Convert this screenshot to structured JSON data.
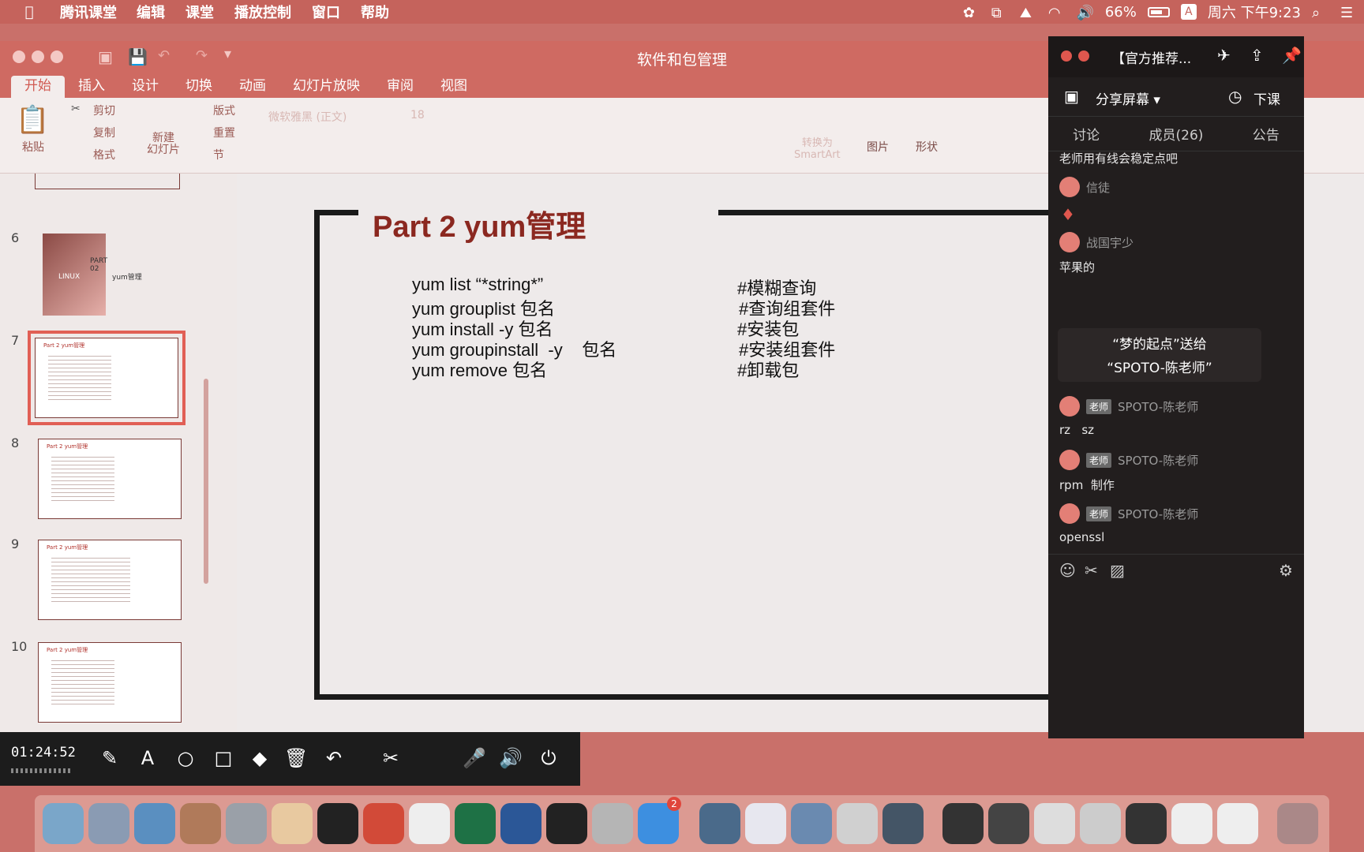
{
  "menubar": {
    "app_name": "腾讯课堂",
    "menus": [
      "编辑",
      "课堂",
      "播放控制",
      "窗口",
      "帮助"
    ],
    "battery": "66%",
    "input_method": "A",
    "clock": "周六 下午9:23"
  },
  "ppt": {
    "doc_title": "软件和包管理",
    "tabs": [
      "开始",
      "插入",
      "设计",
      "切换",
      "动画",
      "幻灯片放映",
      "审阅",
      "视图"
    ],
    "ribbon": {
      "paste": "粘贴",
      "cut": "剪切",
      "copy": "复制",
      "format": "格式",
      "new_slide": "新建\n幻灯片",
      "layout": "版式",
      "reset": "重置",
      "section": "节",
      "font_name": "微软雅黑 (正文)",
      "font_size": "18",
      "smartart": "转换为\nSmartArt",
      "picture": "图片",
      "shape": "形状"
    },
    "thumbnails": [
      {
        "num": "6",
        "title": "PART 02",
        "subtitle": "yum管理",
        "logo": "LINUX"
      },
      {
        "num": "7",
        "title": "Part 2 yum管理"
      },
      {
        "num": "8",
        "title": "Part 2 yum管理"
      },
      {
        "num": "9",
        "title": "Part 2 yum管理"
      },
      {
        "num": "10",
        "title": "Part 2 yum管理"
      }
    ]
  },
  "slide": {
    "title": "Part 2 yum管理",
    "commands": [
      {
        "cmd": "yum list “*string*”",
        "comment": "#模糊查询"
      },
      {
        "cmd": "yum grouplist  包名",
        "comment": "#查询组套件"
      },
      {
        "cmd": "yum install -y 包名",
        "comment": "#安装包"
      },
      {
        "cmd": "yum groupinstall  -y    包名",
        "comment": "#安装组套件"
      },
      {
        "cmd": "yum remove 包名",
        "comment": "#卸载包"
      }
    ]
  },
  "chat": {
    "title": "【官方推荐...",
    "share_screen": "分享屏幕",
    "end_class": "下课",
    "tabs": [
      "讨论",
      "成员(26)",
      "公告"
    ],
    "messages": {
      "top_msg": "老师用有线会稳定点吧",
      "user1": "信徒",
      "user2": "战国宇少",
      "user2_msg": "苹果的",
      "gift_line1": "“梦的起点”送给",
      "gift_line2": "“SPOTO-陈老师”",
      "teacher_badge": "老师",
      "teacher_name": "SPOTO-陈老师",
      "t_msg1": "rz   sz",
      "t_msg2": "rpm  制作",
      "t_msg3": "openssl"
    }
  },
  "recording": {
    "time": "01:24:52"
  },
  "dock": {
    "badge": "2"
  }
}
